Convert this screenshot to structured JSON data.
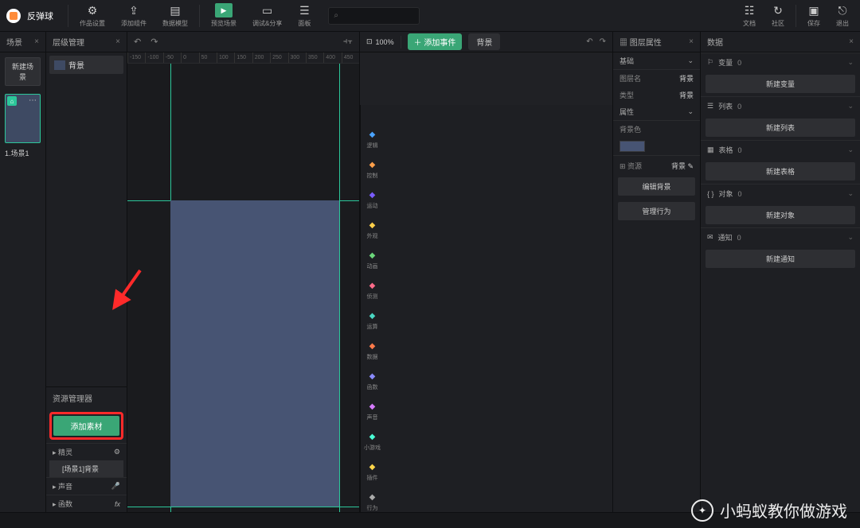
{
  "project_title": "反弹球",
  "top_buttons": {
    "settings": "作品设置",
    "add_plugin": "添加组件",
    "data_model": "数据模型",
    "preview": "预览场景",
    "debug": "调试&分享",
    "panels": "面板",
    "docs": "文档",
    "community": "社区",
    "save": "保存",
    "exit": "退出"
  },
  "search_placeholder": "",
  "scene_panel": {
    "title": "场景",
    "new_scene": "新建场景",
    "scene1_label": "1.场景1"
  },
  "layer_panel": {
    "title": "层级管理",
    "bg_layer": "背景"
  },
  "asset_panel": {
    "title": "资源管理器",
    "add_asset": "添加素材",
    "sprite": "精灵",
    "sprite_item": "[场景1]背景",
    "sound": "声音",
    "func": "函数"
  },
  "canvas": {
    "zoom": "100%",
    "ruler": [
      "-150",
      "-100",
      "-50",
      "0",
      "50",
      "100",
      "150",
      "200",
      "250",
      "300",
      "350",
      "400",
      "450"
    ]
  },
  "blocks": {
    "add_event": "添加事件",
    "bg_chip": "背景",
    "categories": [
      "逻辑",
      "控制",
      "运动",
      "外观",
      "动画",
      "侦测",
      "运算",
      "数据",
      "函数",
      "声音",
      "小游戏",
      "插件",
      "行为"
    ]
  },
  "props": {
    "title": "图层属性",
    "basic": "基础",
    "layer_name_label": "图层名",
    "layer_name_value": "背景",
    "type_label": "类型",
    "type_value": "背景",
    "attr": "属性",
    "bgcolor": "背景色",
    "resource_label": "资源",
    "resource_value": "背景",
    "edit_bg": "编辑背景",
    "manage_behavior": "管理行为"
  },
  "data": {
    "title": "数据",
    "var_label": "变量",
    "var_count": "0",
    "new_var": "新建变量",
    "list_label": "列表",
    "list_count": "0",
    "new_list": "新建列表",
    "table_label": "表格",
    "table_count": "0",
    "new_table": "新建表格",
    "obj_label": "对象",
    "obj_count": "0",
    "new_obj": "新建对象",
    "notify_label": "通知",
    "notify_count": "0",
    "new_notify": "新建通知"
  },
  "watermark": "小蚂蚁教你做游戏"
}
